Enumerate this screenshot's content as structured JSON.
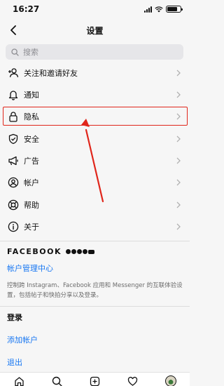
{
  "status_bar": {
    "time": "16:27"
  },
  "header": {
    "title": "设置"
  },
  "search": {
    "placeholder": "搜索"
  },
  "menu": [
    {
      "label": "关注和邀请好友",
      "icon": "add-person-icon"
    },
    {
      "label": "通知",
      "icon": "bell-icon"
    },
    {
      "label": "隐私",
      "icon": "lock-icon",
      "highlighted": true
    },
    {
      "label": "安全",
      "icon": "shield-check-icon"
    },
    {
      "label": "广告",
      "icon": "megaphone-icon"
    },
    {
      "label": "帐户",
      "icon": "account-circle-icon"
    },
    {
      "label": "帮助",
      "icon": "lifebuoy-icon"
    },
    {
      "label": "关于",
      "icon": "info-icon"
    }
  ],
  "meta": {
    "brand": "FACEBOOK",
    "accounts_center": "帐户管理中心",
    "description": "控制跨 Instagram、Facebook 应用和 Messenger 的互联体验设置，包括帖子和快拍分享以及登录。"
  },
  "login": {
    "title": "登录",
    "add_account": "添加帐户",
    "logout": "退出"
  },
  "annotation": {
    "highlight_color": "#e0261b"
  },
  "colors": {
    "link": "#1877f2",
    "background": "#f6f6f6"
  }
}
